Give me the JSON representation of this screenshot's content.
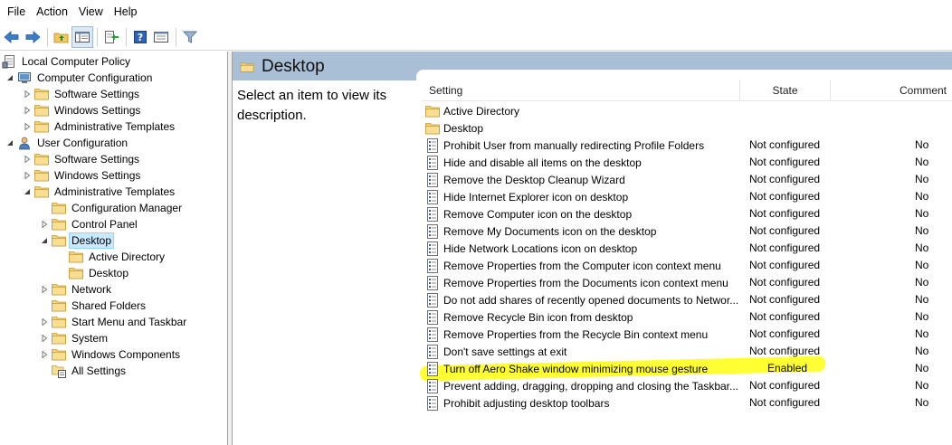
{
  "menu": [
    "File",
    "Action",
    "View",
    "Help"
  ],
  "toolbar": [
    {
      "icon": "back-arrow-icon"
    },
    {
      "icon": "forward-arrow-icon"
    },
    {
      "icon": "up-folder-icon"
    },
    {
      "icon": "show-hide-tree-icon"
    },
    {
      "icon": "export-list-icon"
    },
    {
      "icon": "help-icon"
    },
    {
      "icon": "properties-icon"
    },
    {
      "icon": "filter-icon"
    }
  ],
  "tree": [
    {
      "label": "Local Computer Policy",
      "level": 0,
      "icon": "policy",
      "expander": "none"
    },
    {
      "label": "Computer Configuration",
      "level": 1,
      "icon": "computer",
      "expander": "open"
    },
    {
      "label": "Software Settings",
      "level": 2,
      "icon": "folder",
      "expander": "closed"
    },
    {
      "label": "Windows Settings",
      "level": 2,
      "icon": "folder",
      "expander": "closed"
    },
    {
      "label": "Administrative Templates",
      "level": 2,
      "icon": "folder",
      "expander": "closed"
    },
    {
      "label": "User Configuration",
      "level": 1,
      "icon": "user",
      "expander": "open"
    },
    {
      "label": "Software Settings",
      "level": 2,
      "icon": "folder",
      "expander": "closed"
    },
    {
      "label": "Windows Settings",
      "level": 2,
      "icon": "folder",
      "expander": "closed"
    },
    {
      "label": "Administrative Templates",
      "level": 2,
      "icon": "folder",
      "expander": "open"
    },
    {
      "label": "Configuration Manager",
      "level": 3,
      "icon": "folder",
      "expander": "none"
    },
    {
      "label": "Control Panel",
      "level": 3,
      "icon": "folder",
      "expander": "closed"
    },
    {
      "label": "Desktop",
      "level": 3,
      "icon": "folder",
      "expander": "open",
      "selected": true
    },
    {
      "label": "Active Directory",
      "level": 4,
      "icon": "folder",
      "expander": "none"
    },
    {
      "label": "Desktop",
      "level": 4,
      "icon": "folder",
      "expander": "none"
    },
    {
      "label": "Network",
      "level": 3,
      "icon": "folder",
      "expander": "closed"
    },
    {
      "label": "Shared Folders",
      "level": 3,
      "icon": "folder",
      "expander": "none"
    },
    {
      "label": "Start Menu and Taskbar",
      "level": 3,
      "icon": "folder",
      "expander": "closed"
    },
    {
      "label": "System",
      "level": 3,
      "icon": "folder",
      "expander": "closed"
    },
    {
      "label": "Windows Components",
      "level": 3,
      "icon": "folder",
      "expander": "closed"
    },
    {
      "label": "All Settings",
      "level": 3,
      "icon": "all-settings",
      "expander": "none"
    }
  ],
  "panel": {
    "title": "Desktop",
    "description": "Select an item to view its description."
  },
  "columns": {
    "setting": "Setting",
    "state": "State",
    "comment": "Comment"
  },
  "rows": [
    {
      "name": "Active Directory",
      "type": "folder",
      "state": "",
      "comment": ""
    },
    {
      "name": "Desktop",
      "type": "folder",
      "state": "",
      "comment": ""
    },
    {
      "name": "Prohibit User from manually redirecting Profile Folders",
      "type": "setting",
      "state": "Not configured",
      "comment": "No"
    },
    {
      "name": "Hide and disable all items on the desktop",
      "type": "setting",
      "state": "Not configured",
      "comment": "No"
    },
    {
      "name": "Remove the Desktop Cleanup Wizard",
      "type": "setting",
      "state": "Not configured",
      "comment": "No"
    },
    {
      "name": "Hide Internet Explorer icon on desktop",
      "type": "setting",
      "state": "Not configured",
      "comment": "No"
    },
    {
      "name": "Remove Computer icon on the desktop",
      "type": "setting",
      "state": "Not configured",
      "comment": "No"
    },
    {
      "name": "Remove My Documents icon on the desktop",
      "type": "setting",
      "state": "Not configured",
      "comment": "No"
    },
    {
      "name": "Hide Network Locations icon on desktop",
      "type": "setting",
      "state": "Not configured",
      "comment": "No"
    },
    {
      "name": "Remove Properties from the Computer icon context menu",
      "type": "setting",
      "state": "Not configured",
      "comment": "No"
    },
    {
      "name": "Remove Properties from the Documents icon context menu",
      "type": "setting",
      "state": "Not configured",
      "comment": "No"
    },
    {
      "name": "Do not add shares of recently opened documents to Networ...",
      "type": "setting",
      "state": "Not configured",
      "comment": "No"
    },
    {
      "name": "Remove Recycle Bin icon from desktop",
      "type": "setting",
      "state": "Not configured",
      "comment": "No"
    },
    {
      "name": "Remove Properties from the Recycle Bin context menu",
      "type": "setting",
      "state": "Not configured",
      "comment": "No"
    },
    {
      "name": "Don't save settings at exit",
      "type": "setting",
      "state": "Not configured",
      "comment": "No"
    },
    {
      "name": "Turn off Aero Shake window minimizing mouse gesture",
      "type": "setting",
      "state": "Enabled",
      "comment": "No",
      "highlight": true
    },
    {
      "name": "Prevent adding, dragging, dropping and closing the Taskbar...",
      "type": "setting",
      "state": "Not configured",
      "comment": "No"
    },
    {
      "name": "Prohibit adjusting desktop toolbars",
      "type": "setting",
      "state": "Not configured",
      "comment": "No"
    }
  ]
}
